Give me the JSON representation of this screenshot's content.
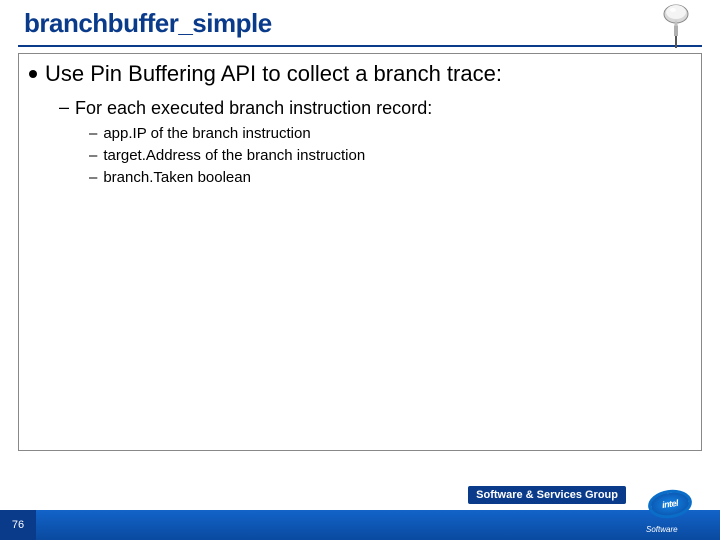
{
  "title": "branchbuffer_simple",
  "bullets": {
    "l1": "Use Pin Buffering API to collect a branch trace:",
    "l2": "For each executed branch instruction record:",
    "l3": [
      "app.IP of the branch instruction",
      "target.Address of the branch instruction",
      "branch.Taken boolean"
    ]
  },
  "footer": {
    "group": "Software & Services Group",
    "page": "76",
    "brand": "intel",
    "brand_sub": "Software"
  }
}
